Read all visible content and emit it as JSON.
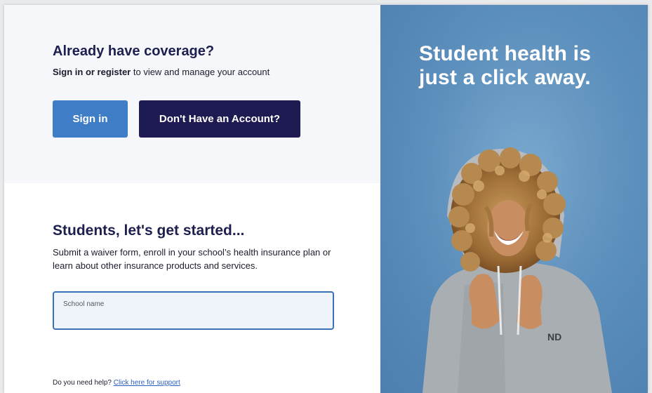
{
  "coverage": {
    "title": "Already have coverage?",
    "subtitle_bold": "Sign in or register",
    "subtitle_rest": " to view and manage your account",
    "signin_label": "Sign in",
    "no_account_label": "Don't Have an Account?"
  },
  "start": {
    "title": "Students, let's get started...",
    "description": "Submit a waiver form, enroll in your school’s health insurance plan or learn about other insurance products and services.",
    "school_label": "School name",
    "school_value": ""
  },
  "help": {
    "prefix": "Do you need help? ",
    "link": "Click here for support"
  },
  "hero": {
    "line1": "Student health is",
    "line2": "just a click away.",
    "photo_icon": "smiling-student-photo",
    "background_color": "#5b8fbc"
  },
  "colors": {
    "primary_blue": "#3f7ec6",
    "navy": "#1e1a52",
    "heading": "#1d1f4f"
  }
}
